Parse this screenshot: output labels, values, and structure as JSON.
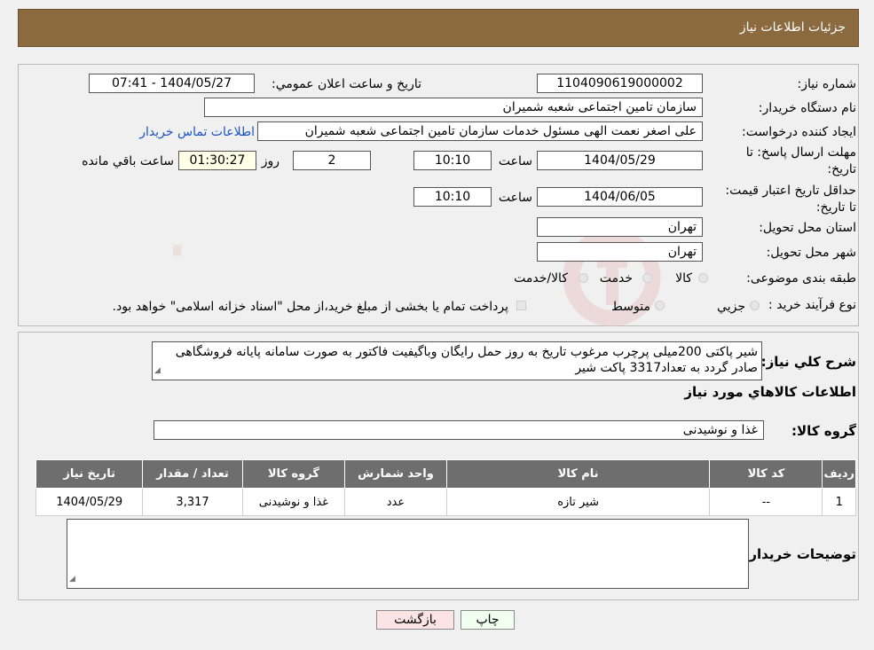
{
  "header": {
    "title": "جزئیات اطلاعات نیاز"
  },
  "form": {
    "need_number_label": "شماره نیاز:",
    "need_number": "1104090619000002",
    "announce_label": "تاریخ و ساعت اعلان عمومي:",
    "announce_value": "1404/05/27 - 07:41",
    "buyer_org_label": "نام دستگاه خریدار:",
    "buyer_org": "سازمان تامین اجتماعی شعبه شمیران",
    "creator_label": "ایجاد کننده درخواست:",
    "creator": "علی اصغر نعمت الهی مسئول خدمات سازمان تامین اجتماعی شعبه شمیران",
    "contact_link": "اطلاعات تماس خریدار",
    "deadline_label": "مهلت ارسال پاسخ: تا تاریخ:",
    "deadline_date": "1404/05/29",
    "time_label": "ساعت",
    "deadline_time": "10:10",
    "days_value": "2",
    "days_label": "روز و",
    "remaining_value": "01:30:27",
    "remaining_label": "ساعت باقي مانده",
    "validity_label": "حداقل تاریخ اعتبار قیمت: تا تاریخ:",
    "validity_date": "1404/06/05",
    "validity_time": "10:10",
    "province_label": "استان محل تحویل:",
    "province": "تهران",
    "city_label": "شهر محل تحویل:",
    "city": "تهران",
    "category_label": "طبقه بندی موضوعی:",
    "category_options": [
      "کالا",
      "خدمت",
      "کالا/خدمت"
    ],
    "process_label": "نوع فرآیند خرید :",
    "process_options": [
      "جزيي",
      "متوسط"
    ],
    "process_note": "پرداخت تمام یا بخشی از مبلغ خرید،از محل \"اسناد خزانه اسلامی\" خواهد بود."
  },
  "description": {
    "label": "شرح کلي نياز:",
    "text": "شیر پاکتی 200میلی پرچرب مرغوب تاریخ به روز حمل رایگان  وباگیفیت فاکتور به صورت سامانه پایانه فروشگاهی صادر گردد به تعداد3317 پاکت شیر"
  },
  "goods": {
    "section_title": "اطلاعات کالاهاي مورد نياز",
    "group_label": "گروه کالا:",
    "group_value": "غذا و نوشیدنی",
    "columns": [
      "رديف",
      "کد کالا",
      "نام کالا",
      "واحد شمارش",
      "گروه کالا",
      "تعداد / مقدار",
      "تاریخ نیاز"
    ],
    "rows": [
      [
        "1",
        "--",
        "شیر تازه",
        "عدد",
        "غذا و نوشیدنی",
        "3,317",
        "1404/05/29"
      ]
    ]
  },
  "buyer_notes": {
    "label": "توضیحات خریدار:",
    "text": ""
  },
  "buttons": {
    "print": "چاپ",
    "back": "بازگشت"
  },
  "colors": {
    "header_bg": "#8c6a40",
    "table_header_bg": "#6e6e6e",
    "link": "#1a53c7",
    "back_button_bg": "#fce4e4"
  }
}
